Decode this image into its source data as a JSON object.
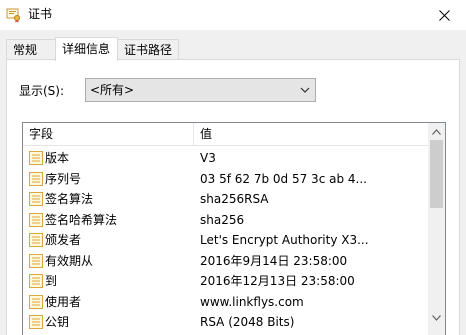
{
  "window": {
    "title": "证书",
    "close_icon": "close-icon",
    "app_icon": "certificate-icon"
  },
  "tabs": [
    {
      "label": "常规",
      "active": false
    },
    {
      "label": "详细信息",
      "active": true
    },
    {
      "label": "证书路径",
      "active": false
    }
  ],
  "details": {
    "show_label": "显示(S):",
    "show_value": "<所有>",
    "columns": [
      "字段",
      "值"
    ],
    "rows": [
      {
        "field": "版本",
        "value": "V3"
      },
      {
        "field": "序列号",
        "value": "03 5f 62 7b 0d 57 3c ab 4..."
      },
      {
        "field": "签名算法",
        "value": "sha256RSA"
      },
      {
        "field": "签名哈希算法",
        "value": "sha256"
      },
      {
        "field": "颁发者",
        "value": "Let's Encrypt Authority X3..."
      },
      {
        "field": "有效期从",
        "value": "2016年9月14日 23:58:00"
      },
      {
        "field": "到",
        "value": "2016年12月13日 23:58:00"
      },
      {
        "field": "使用者",
        "value": "www.linkflys.com"
      },
      {
        "field": "公钥",
        "value": "RSA (2048 Bits)"
      }
    ]
  },
  "colors": {
    "dialog_bg": "#f0f0f0",
    "panel_bg": "#ffffff",
    "border": "#d9d9d9",
    "icon_gold": "#d8a940"
  }
}
